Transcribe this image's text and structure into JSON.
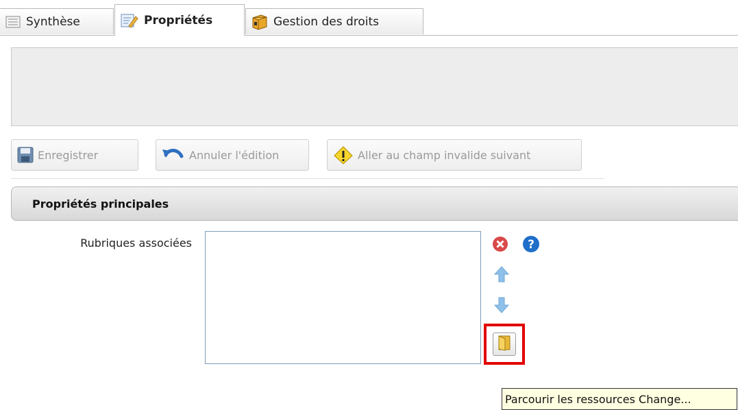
{
  "tabs": [
    {
      "label": "Synthèse",
      "icon": "summary-list-icon"
    },
    {
      "label": "Propriétés",
      "icon": "edit-properties-icon",
      "active": true
    },
    {
      "label": "Gestion des droits",
      "icon": "rights-box-icon"
    }
  ],
  "toolbar": {
    "save_label": "Enregistrer",
    "undo_label": "Annuler l'édition",
    "invalid_label": "Aller au champ invalide suivant"
  },
  "section": {
    "title": "Propriétés principales"
  },
  "field": {
    "label": "Rubriques associées",
    "buttons": [
      "remove-icon",
      "help-icon",
      "arrow-up-icon",
      "arrow-down-icon",
      "browse-folder-icon"
    ]
  },
  "tooltip": {
    "text": "Parcourir les ressources Change..."
  },
  "colors": {
    "highlight_frame": "#e20000",
    "remove": "#d94a4a",
    "help": "#1f6ec9",
    "arrow": "#8fc0ea",
    "tooltip_bg": "#ffffe1"
  }
}
